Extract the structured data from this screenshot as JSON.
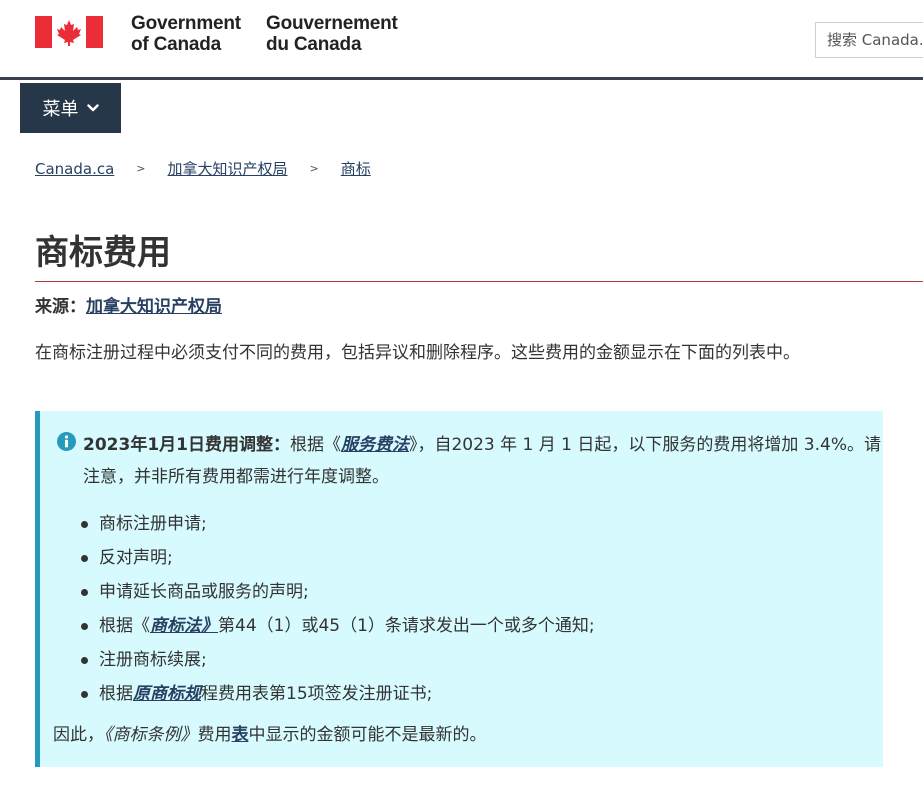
{
  "header": {
    "signature_en": [
      "Government",
      "of Canada"
    ],
    "signature_fr": [
      "Gouvernement",
      "du Canada"
    ],
    "search_placeholder": "搜索 Canada.ca",
    "colors": {
      "flag_red": "#eb2d37",
      "rule": "#38414d"
    }
  },
  "menu": {
    "label": "菜单",
    "icon": "chevron-down-icon"
  },
  "breadcrumb": {
    "items": [
      "Canada.ca",
      "加拿大知识产权局",
      "商标"
    ],
    "separator": ">"
  },
  "page": {
    "title": "商标费用",
    "source_label": "来源：",
    "source_link": "加拿大知识产权局",
    "intro": "在商标注册过程中必须支付不同的费用，包括异议和删除程序。这些费用的金额显示在下面的列表中。"
  },
  "alert": {
    "icon": "info-icon",
    "heading_bold": "2023年1月1日费用调整：",
    "heading_pre": "根据《",
    "heading_link": "服务费法",
    "heading_post": "》，自2023 年 1 月 1 日起，以下服务的费用将增加 3.4%。请注意，并非所有费用都需进行年度调整。",
    "items": [
      {
        "text": "商标注册申请;"
      },
      {
        "text": "反对声明;"
      },
      {
        "text": "申请延长商品或服务的声明;"
      },
      {
        "pre": "根据《",
        "link": "商标法》",
        "post": "第44（1）或45（1）条请求发出一个或多个通知;"
      },
      {
        "text": "注册商标续展;"
      },
      {
        "pre": "根据",
        "link": "原商标规",
        "post": "程费用表第15项签发注册证书;"
      }
    ],
    "footer_pre": "因此，",
    "footer_italic": "《商标条例》",
    "footer_mid": "费用",
    "footer_link": "表",
    "footer_post": "中显示的金额可能不是最新的。",
    "colors": {
      "background": "#d7faff",
      "border": "#269abc"
    }
  }
}
